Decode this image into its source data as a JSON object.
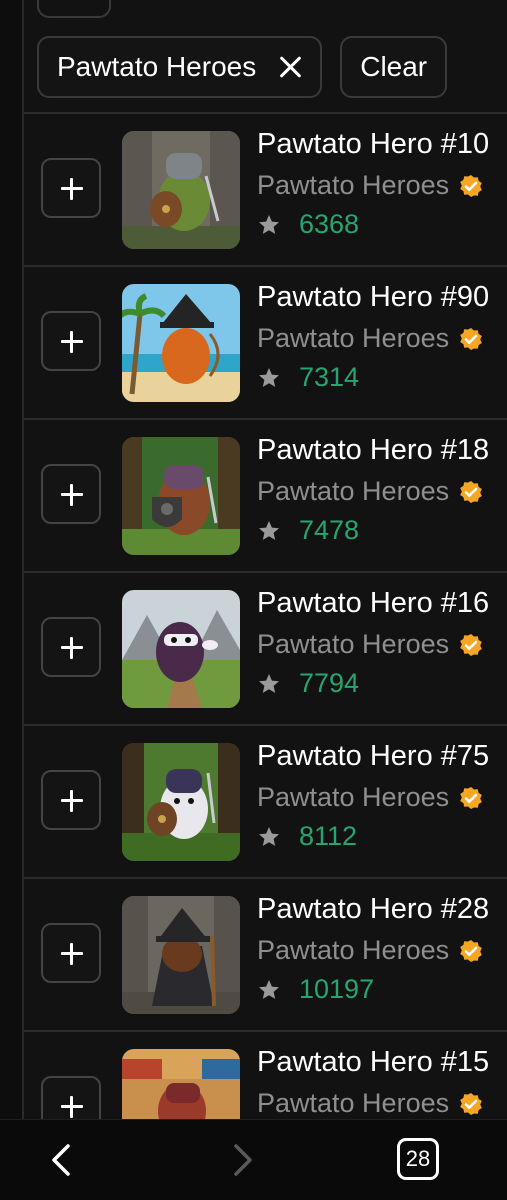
{
  "filter": {
    "chip_label": "Pawtato Heroes",
    "clear_label": "Clear"
  },
  "colors": {
    "accent_green": "#27a56e",
    "verified_orange": "#f5a623",
    "background": "#121212"
  },
  "items": [
    {
      "title": "Pawtato Hero #10",
      "collection": "Pawtato Heroes",
      "rank": "6368"
    },
    {
      "title": "Pawtato Hero #90",
      "collection": "Pawtato Heroes",
      "rank": "7314"
    },
    {
      "title": "Pawtato Hero #18",
      "collection": "Pawtato Heroes",
      "rank": "7478"
    },
    {
      "title": "Pawtato Hero #16",
      "collection": "Pawtato Heroes",
      "rank": "7794"
    },
    {
      "title": "Pawtato Hero #75",
      "collection": "Pawtato Heroes",
      "rank": "8112"
    },
    {
      "title": "Pawtato Hero #28",
      "collection": "Pawtato Heroes",
      "rank": "10197"
    },
    {
      "title": "Pawtato Hero #15",
      "collection": "Pawtato Heroes",
      "rank": ""
    }
  ],
  "browser": {
    "tab_count": "28"
  },
  "icons": {
    "close": "close-icon",
    "add": "plus-icon",
    "verified": "verified-badge-icon",
    "star": "star-icon",
    "back": "chevron-left-icon",
    "forward": "chevron-right-icon"
  }
}
